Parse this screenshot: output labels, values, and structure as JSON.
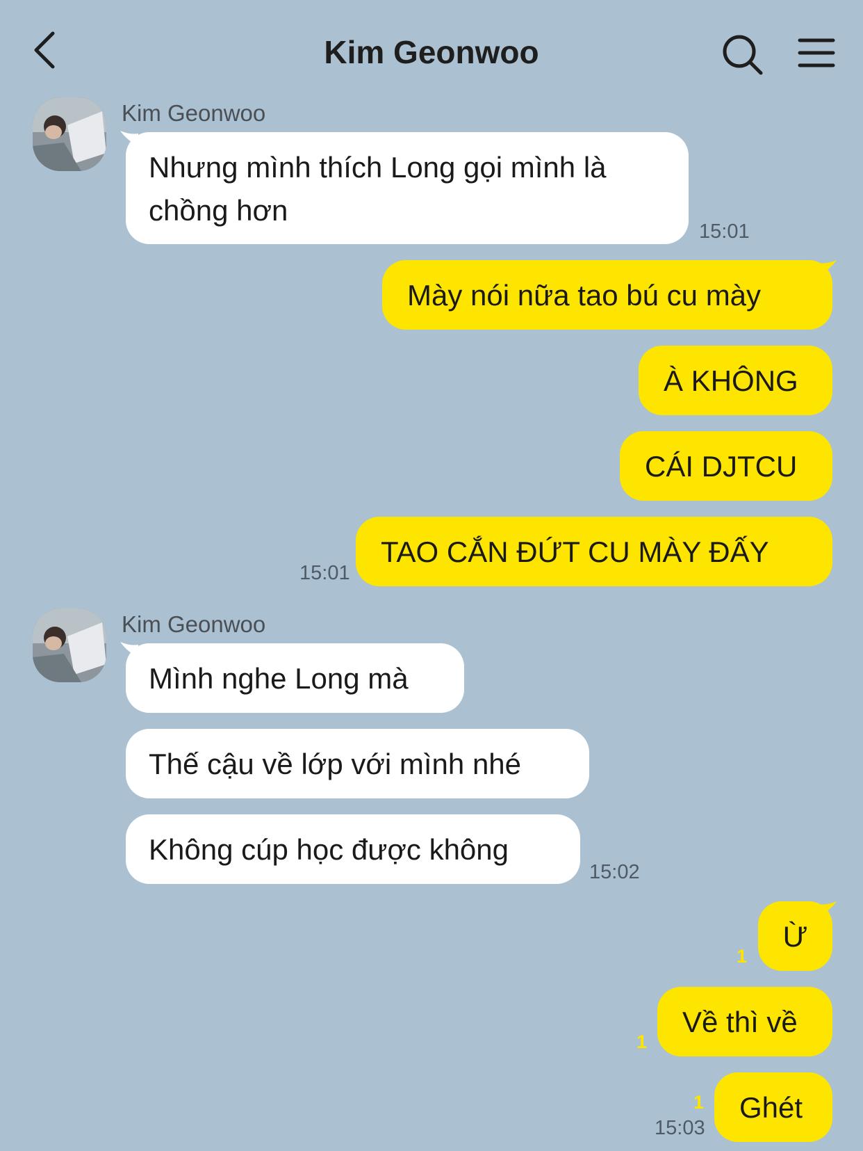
{
  "header": {
    "title": "Kim Geonwoo"
  },
  "colors": {
    "background": "#abc1d1",
    "outgoing_bubble": "#fee500",
    "incoming_bubble": "#ffffff",
    "unread_count": "#fee500"
  },
  "groups": [
    {
      "sender": "Kim Geonwoo",
      "messages": [
        {
          "text_line1": "Nhưng mình thích Long gọi mình là",
          "text_line2": "chồng hơn",
          "time": "15:01"
        }
      ]
    },
    {
      "sender": "me",
      "messages": [
        {
          "text": "Mày nói nữa tao bú cu mày"
        },
        {
          "text": "À KHÔNG"
        },
        {
          "text": "CÁI DJTCU"
        },
        {
          "text": "TAO CẮN ĐỨT CU MÀY ĐẤY",
          "time": "15:01"
        }
      ]
    },
    {
      "sender": "Kim Geonwoo",
      "messages": [
        {
          "text": "Mình nghe Long mà"
        },
        {
          "text": "Thế cậu về lớp với mình nhé"
        },
        {
          "text": "Không cúp học được không",
          "time": "15:02"
        }
      ]
    },
    {
      "sender": "me",
      "messages": [
        {
          "text": "Ừ",
          "unread": "1"
        },
        {
          "text": "Về thì về",
          "unread": "1"
        },
        {
          "text": "Ghét",
          "unread": "1",
          "time": "15:03"
        }
      ]
    }
  ]
}
